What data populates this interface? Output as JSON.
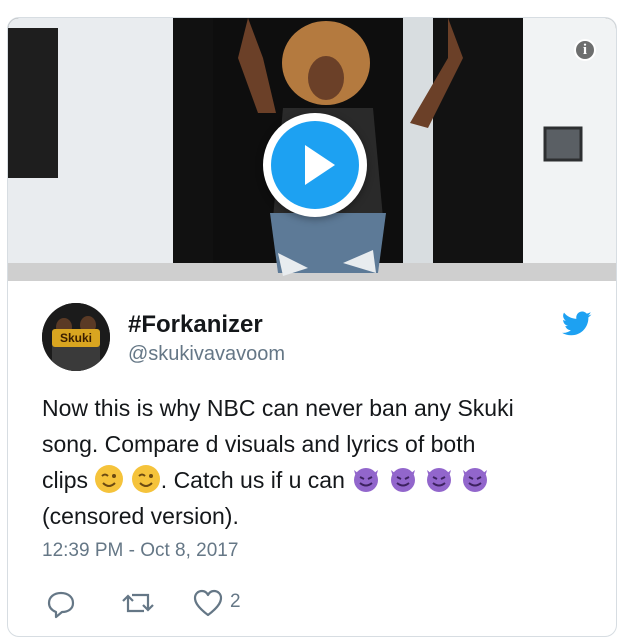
{
  "media": {
    "type": "video",
    "play_icon": "play-icon",
    "info_icon": "info-icon",
    "info_label": "i"
  },
  "author": {
    "name": "#Forkanizer",
    "handle": "@skukivavavoom",
    "avatar_text": "Skuki"
  },
  "tweet": {
    "text_line1": "Now this is why NBC can never ban any Skuki",
    "text_line2": "song. Compare d visuals and lyrics of both",
    "text_line3a": "clips ",
    "text_line3b": ". Catch us if u can ",
    "text_line4": "(censored version).",
    "emoji_wink": "winking-face",
    "emoji_devil": "smiling-face-with-horns",
    "timestamp": "12:39 PM - Oct 8, 2017"
  },
  "actions": {
    "reply_icon": "reply-icon",
    "retweet_icon": "retweet-icon",
    "like_icon": "heart-icon",
    "like_count": "2"
  },
  "colors": {
    "twitter_blue": "#1da1f2",
    "text": "#14171a",
    "secondary": "#657786",
    "emoji_yellow": "#f5c33b",
    "emoji_purple": "#9266cc"
  }
}
